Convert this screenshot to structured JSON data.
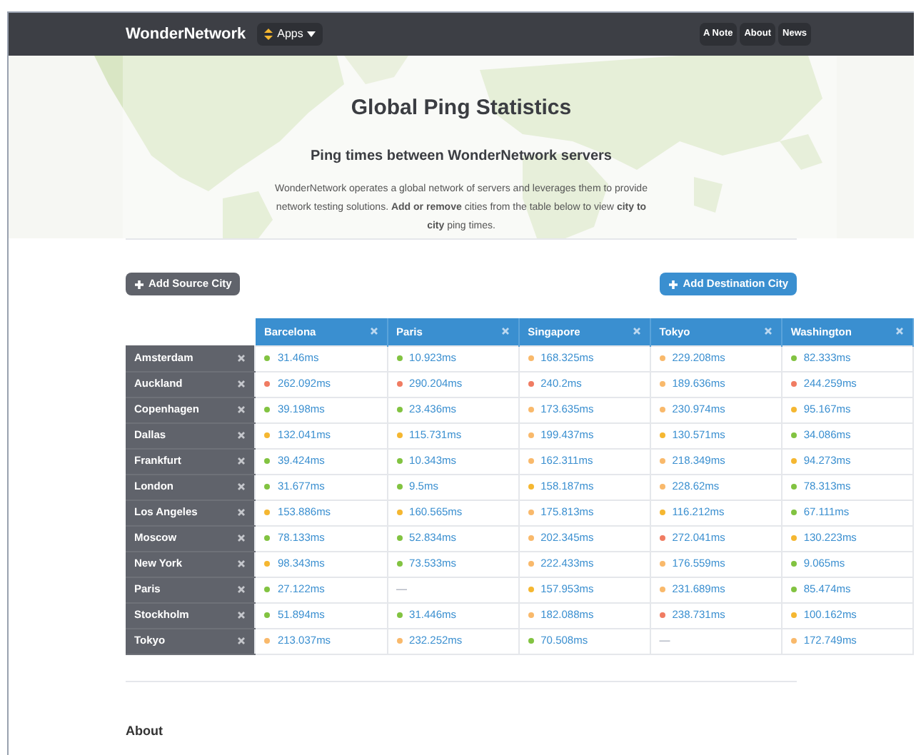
{
  "navbar": {
    "brand": "WonderNetwork",
    "apps_menu": {
      "label": "Apps"
    },
    "links": [
      {
        "label": "A Note"
      },
      {
        "label": "About"
      },
      {
        "label": "News"
      }
    ]
  },
  "hero": {
    "title": "Global Ping Statistics",
    "subtitle": "Ping times between WonderNetwork servers",
    "description": "WonderNetwork operates a global network of servers and leverages them to provide network testing solutions. **Add or remove** cities from the table below to view **city to city** ping times."
  },
  "actions": {
    "add_source": "Add Source City",
    "add_destination": "Add Destination City"
  },
  "table": {
    "columns": [
      "Barcelona",
      "Paris",
      "Singapore",
      "Tokyo",
      "Washington"
    ],
    "rows": [
      {
        "city": "Amsterdam",
        "cells": [
          {
            "value": "31.46ms",
            "color": "#82c341"
          },
          {
            "value": "10.923ms",
            "color": "#82c341"
          },
          {
            "value": "168.325ms",
            "color": "#f9b96b"
          },
          {
            "value": "229.208ms",
            "color": "#f9b96b"
          },
          {
            "value": "82.333ms",
            "color": "#82c341"
          }
        ]
      },
      {
        "city": "Auckland",
        "cells": [
          {
            "value": "262.092ms",
            "color": "#f07c62"
          },
          {
            "value": "290.204ms",
            "color": "#f07c62"
          },
          {
            "value": "240.2ms",
            "color": "#f07c62"
          },
          {
            "value": "189.636ms",
            "color": "#f9b96b"
          },
          {
            "value": "244.259ms",
            "color": "#f07c62"
          }
        ]
      },
      {
        "city": "Copenhagen",
        "cells": [
          {
            "value": "39.198ms",
            "color": "#82c341"
          },
          {
            "value": "23.436ms",
            "color": "#82c341"
          },
          {
            "value": "173.635ms",
            "color": "#f9b96b"
          },
          {
            "value": "230.974ms",
            "color": "#f9b96b"
          },
          {
            "value": "95.167ms",
            "color": "#f5b731"
          }
        ]
      },
      {
        "city": "Dallas",
        "cells": [
          {
            "value": "132.041ms",
            "color": "#f5b731"
          },
          {
            "value": "115.731ms",
            "color": "#f5b731"
          },
          {
            "value": "199.437ms",
            "color": "#f9b96b"
          },
          {
            "value": "130.571ms",
            "color": "#f5b731"
          },
          {
            "value": "34.086ms",
            "color": "#82c341"
          }
        ]
      },
      {
        "city": "Frankfurt",
        "cells": [
          {
            "value": "39.424ms",
            "color": "#82c341"
          },
          {
            "value": "10.343ms",
            "color": "#82c341"
          },
          {
            "value": "162.311ms",
            "color": "#f9b96b"
          },
          {
            "value": "218.349ms",
            "color": "#f9b96b"
          },
          {
            "value": "94.273ms",
            "color": "#f5b731"
          }
        ]
      },
      {
        "city": "London",
        "cells": [
          {
            "value": "31.677ms",
            "color": "#82c341"
          },
          {
            "value": "9.5ms",
            "color": "#82c341"
          },
          {
            "value": "158.187ms",
            "color": "#f5b731"
          },
          {
            "value": "228.62ms",
            "color": "#f9b96b"
          },
          {
            "value": "78.313ms",
            "color": "#82c341"
          }
        ]
      },
      {
        "city": "Los Angeles",
        "cells": [
          {
            "value": "153.886ms",
            "color": "#f5b731"
          },
          {
            "value": "160.565ms",
            "color": "#f5b731"
          },
          {
            "value": "175.813ms",
            "color": "#f9b96b"
          },
          {
            "value": "116.212ms",
            "color": "#f5b731"
          },
          {
            "value": "67.111ms",
            "color": "#82c341"
          }
        ]
      },
      {
        "city": "Moscow",
        "cells": [
          {
            "value": "78.133ms",
            "color": "#82c341"
          },
          {
            "value": "52.834ms",
            "color": "#82c341"
          },
          {
            "value": "202.345ms",
            "color": "#f9b96b"
          },
          {
            "value": "272.041ms",
            "color": "#f07c62"
          },
          {
            "value": "130.223ms",
            "color": "#f5b731"
          }
        ]
      },
      {
        "city": "New York",
        "cells": [
          {
            "value": "98.343ms",
            "color": "#f5b731"
          },
          {
            "value": "73.533ms",
            "color": "#82c341"
          },
          {
            "value": "222.433ms",
            "color": "#f9b96b"
          },
          {
            "value": "176.559ms",
            "color": "#f9b96b"
          },
          {
            "value": "9.065ms",
            "color": "#82c341"
          }
        ]
      },
      {
        "city": "Paris",
        "cells": [
          {
            "value": "27.122ms",
            "color": "#82c341"
          },
          {
            "value": "—"
          },
          {
            "value": "157.953ms",
            "color": "#f5b731"
          },
          {
            "value": "231.689ms",
            "color": "#f9b96b"
          },
          {
            "value": "85.474ms",
            "color": "#82c341"
          }
        ]
      },
      {
        "city": "Stockholm",
        "cells": [
          {
            "value": "51.894ms",
            "color": "#82c341"
          },
          {
            "value": "31.446ms",
            "color": "#82c341"
          },
          {
            "value": "182.088ms",
            "color": "#f9b96b"
          },
          {
            "value": "238.731ms",
            "color": "#f07c62"
          },
          {
            "value": "100.162ms",
            "color": "#f5b731"
          }
        ]
      },
      {
        "city": "Tokyo",
        "cells": [
          {
            "value": "213.037ms",
            "color": "#f9b96b"
          },
          {
            "value": "232.252ms",
            "color": "#f9b96b"
          },
          {
            "value": "70.508ms",
            "color": "#82c341"
          },
          {
            "value": "—"
          },
          {
            "value": "172.749ms",
            "color": "#f9b96b"
          }
        ]
      }
    ]
  },
  "about": {
    "heading": "About"
  }
}
